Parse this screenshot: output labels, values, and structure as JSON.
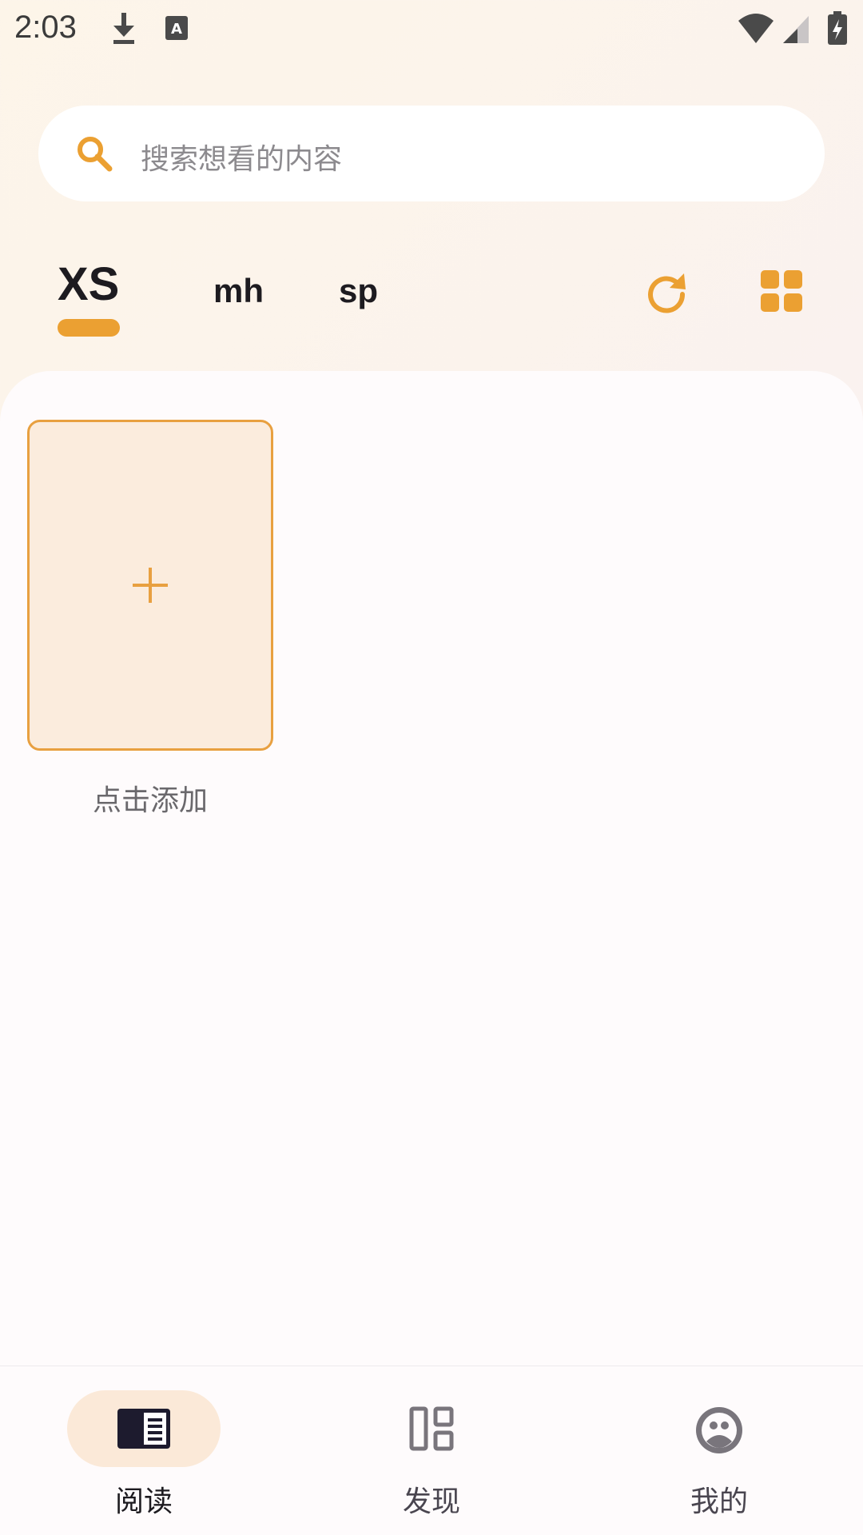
{
  "status_bar": {
    "time": "2:03",
    "icons": [
      "download-icon",
      "a-text-icon",
      "wifi-icon",
      "signal-icon",
      "battery-charging-icon"
    ]
  },
  "search": {
    "placeholder": "搜索想看的内容",
    "icon": "search-icon"
  },
  "tabs": [
    {
      "label": "XS",
      "active": true
    },
    {
      "label": "mh",
      "active": false
    },
    {
      "label": "sp",
      "active": false
    }
  ],
  "toolbar": {
    "refresh_icon": "refresh-icon",
    "grid_icon": "grid-view-icon"
  },
  "library": {
    "add_card_label": "点击添加",
    "add_icon": "plus-icon"
  },
  "bottom_nav": [
    {
      "label": "阅读",
      "icon": "book-icon",
      "active": true
    },
    {
      "label": "发现",
      "icon": "explore-layout-icon",
      "active": false
    },
    {
      "label": "我的",
      "icon": "profile-face-icon",
      "active": false
    }
  ],
  "colors": {
    "accent": "#eba032",
    "card_bg": "#fbecdd",
    "nav_pill": "#fbe9d8",
    "text_primary": "#1d1b20",
    "text_secondary": "#6a686c"
  }
}
